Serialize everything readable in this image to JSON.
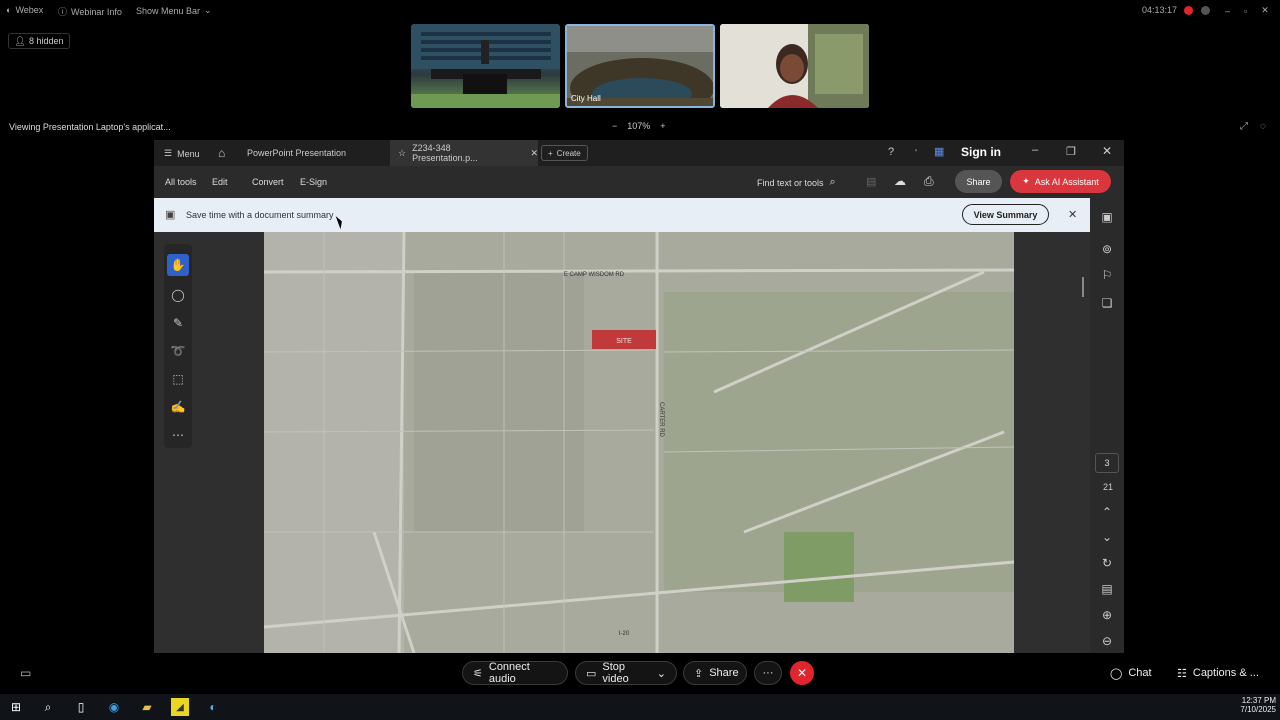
{
  "topbar": {
    "app_name": "Webex",
    "webinar_info": "Webinar Info",
    "show_menu_bar": "Show Menu Bar",
    "timer": "04:13:17"
  },
  "participants": {
    "hidden_label": "8 hidden",
    "thumb2_label": "City Hall"
  },
  "share": {
    "viewing_label": "Viewing Presentation Laptop's applicat...",
    "zoom_level": "107%",
    "zoom_out": "−",
    "zoom_in": "+"
  },
  "acrobat": {
    "menu_label": "Menu",
    "tab1": "PowerPoint Presentation",
    "tab2": "Z234-348 Presentation.p...",
    "create_label": "Create",
    "sign_in": "Sign in",
    "menus": [
      "All tools",
      "Edit",
      "Convert",
      "E-Sign"
    ],
    "find_label": "Find text or tools",
    "share_label": "Share",
    "ai_label": "Ask AI Assistant",
    "notice_text": "Save time with a document summary",
    "view_summary": "View Summary",
    "page_current": "3",
    "page_total": "21"
  },
  "map": {
    "road_top": "E CAMP WISDOM RD",
    "site_label": "SITE",
    "road_bottom": "I-20",
    "road_vertical": "CARTER RD"
  },
  "controls": {
    "connect_audio": "Connect audio",
    "stop_video": "Stop video",
    "share": "Share",
    "more": "···",
    "chat": "Chat",
    "captions": "Captions & ..."
  },
  "taskbar": {
    "time": "12:37 PM",
    "date": "7/10/2025"
  },
  "colors": {
    "accent_blue": "#3d6fd1",
    "ai_red": "#d9363e",
    "site_red": "#c0393b",
    "end_red": "#e0252f"
  }
}
